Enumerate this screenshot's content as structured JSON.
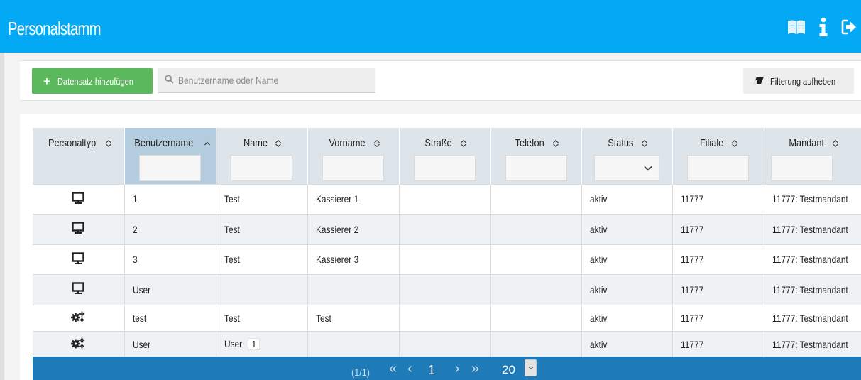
{
  "header": {
    "title": "Personalstamm",
    "icons": [
      "book-icon",
      "info-icon",
      "logout-icon"
    ]
  },
  "toolbar": {
    "add_label": "Datensatz hinzufügen",
    "search_placeholder": "Benutzername oder Name",
    "clear_filter_label": "Filterung aufheben"
  },
  "table": {
    "columns": [
      "Personaltyp",
      "Benutzername",
      "Name",
      "Vorname",
      "Straße",
      "Telefon",
      "Status",
      "Filiale",
      "Mandant"
    ],
    "sorted_column": "Benutzername",
    "rows": [
      {
        "type_icon": "monitor-icon",
        "benutzername": "1",
        "name": "Test",
        "vorname": "Kassierer 1",
        "strasse": "",
        "telefon": "",
        "status": "aktiv",
        "filiale": "11777",
        "mandant": "11777: Testmandant"
      },
      {
        "type_icon": "monitor-icon",
        "benutzername": "2",
        "name": "Test",
        "vorname": "Kassierer 2",
        "strasse": "",
        "telefon": "",
        "status": "aktiv",
        "filiale": "11777",
        "mandant": "11777: Testmandant"
      },
      {
        "type_icon": "monitor-icon",
        "benutzername": "3",
        "name": "Test",
        "vorname": "Kassierer 3",
        "strasse": "",
        "telefon": "",
        "status": "aktiv",
        "filiale": "11777",
        "mandant": "11777: Testmandant"
      },
      {
        "type_icon": "monitor-icon",
        "benutzername": "User",
        "name": "",
        "vorname": "",
        "strasse": "",
        "telefon": "",
        "status": "aktiv",
        "filiale": "11777",
        "mandant": "11777: Testmandant"
      },
      {
        "type_icon": "gears-icon",
        "benutzername": "test",
        "name": "Test",
        "vorname": "Test",
        "strasse": "",
        "telefon": "",
        "status": "aktiv",
        "filiale": "11777",
        "mandant": "11777: Testmandant"
      },
      {
        "type_icon": "gears-icon",
        "benutzername": "User",
        "name": "User",
        "name_extra": "1",
        "vorname": "",
        "strasse": "",
        "telefon": "",
        "status": "aktiv",
        "filiale": "11777",
        "mandant": "11777: Testmandant"
      }
    ]
  },
  "pagination": {
    "info": "(1/1)",
    "first": "«",
    "prev": "‹",
    "current_page": "1",
    "next": "›",
    "last": "»",
    "page_size": "20"
  }
}
